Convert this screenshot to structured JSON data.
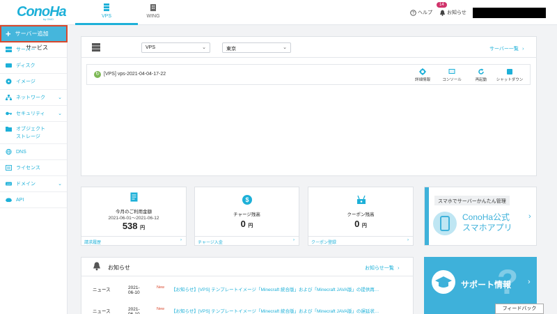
{
  "header": {
    "logo": "ConoHa",
    "logo_sub": "by GMO",
    "tabs": [
      {
        "label": "VPS",
        "icon": "server-stack-icon",
        "active": true
      },
      {
        "label": "WING",
        "icon": "building-icon",
        "active": false
      }
    ],
    "help_label": "ヘルプ",
    "notifications_label": "お知らせ",
    "notifications_count": "14"
  },
  "sidebar": {
    "add_server_label": "サーバー追加",
    "items": [
      {
        "label": "サーバー",
        "icon": "server-icon",
        "has_submenu": false
      },
      {
        "label": "ディスク",
        "icon": "disk-icon",
        "has_submenu": false
      },
      {
        "label": "イメージ",
        "icon": "image-icon",
        "has_submenu": false
      },
      {
        "label": "ネットワーク",
        "icon": "network-icon",
        "has_submenu": true
      },
      {
        "label": "セキュリティ",
        "icon": "key-icon",
        "has_submenu": true
      },
      {
        "label": "オブジェクト",
        "label2": "ストレージ",
        "icon": "folder-icon",
        "has_submenu": false
      },
      {
        "label": "DNS",
        "icon": "globe-icon",
        "has_submenu": false
      },
      {
        "label": "ライセンス",
        "icon": "license-icon",
        "has_submenu": false
      },
      {
        "label": "ドメイン",
        "icon": "domain-icon",
        "has_submenu": true
      },
      {
        "label": "API",
        "icon": "api-icon",
        "has_submenu": false
      }
    ]
  },
  "services": {
    "title": "サービス",
    "service_select": "VPS",
    "region_select": "東京",
    "list_link": "サーバー一覧",
    "vm": {
      "name": "[VPS] vps-2021-04-04-17-22",
      "actions": [
        "詳細情報",
        "コンソール",
        "再起動",
        "シャットダウン"
      ]
    }
  },
  "stats": [
    {
      "title": "今月のご利用金額",
      "period": "2021-06-01〜2021-06-12",
      "value": "538",
      "unit": "円",
      "footer": "請求履歴",
      "icon": "invoice-icon"
    },
    {
      "title": "チャージ残高",
      "value": "0",
      "unit": "円",
      "footer": "チャージ入金",
      "icon": "dollar-icon"
    },
    {
      "title": "クーポン残高",
      "value": "0",
      "unit": "円",
      "footer": "クーポン登録",
      "icon": "coupon-icon"
    }
  ],
  "news": {
    "title": "お知らせ",
    "list_link": "お知らせ一覧",
    "items": [
      {
        "category": "ニュース",
        "date": "2021-06-10",
        "badge": "New",
        "title": "【お知らせ】[VPS] テンプレートイメージ「Minecraft 統合版」および「Minecraft JAVA版」の提供再…"
      },
      {
        "category": "ニュース",
        "date": "2021-06-10",
        "badge": "New",
        "title": "【お知らせ】[VPS] テンプレートイメージ「Minecraft 統合版」および「Minecraft JAVA版」の遅延状…"
      }
    ]
  },
  "promo": {
    "mobile_heading": "スマホでサーバーかんたん管理",
    "mobile_title1": "ConoHa公式",
    "mobile_title2": "スマホアプリ",
    "support_title": "サポート情報"
  },
  "feedback_label": "フィードバック",
  "colors": {
    "accent": "#1db0d8",
    "add_button": "#45b6dc",
    "highlight": "#d9472b",
    "badge": "#d0336b",
    "status_ok": "#7cb854"
  }
}
